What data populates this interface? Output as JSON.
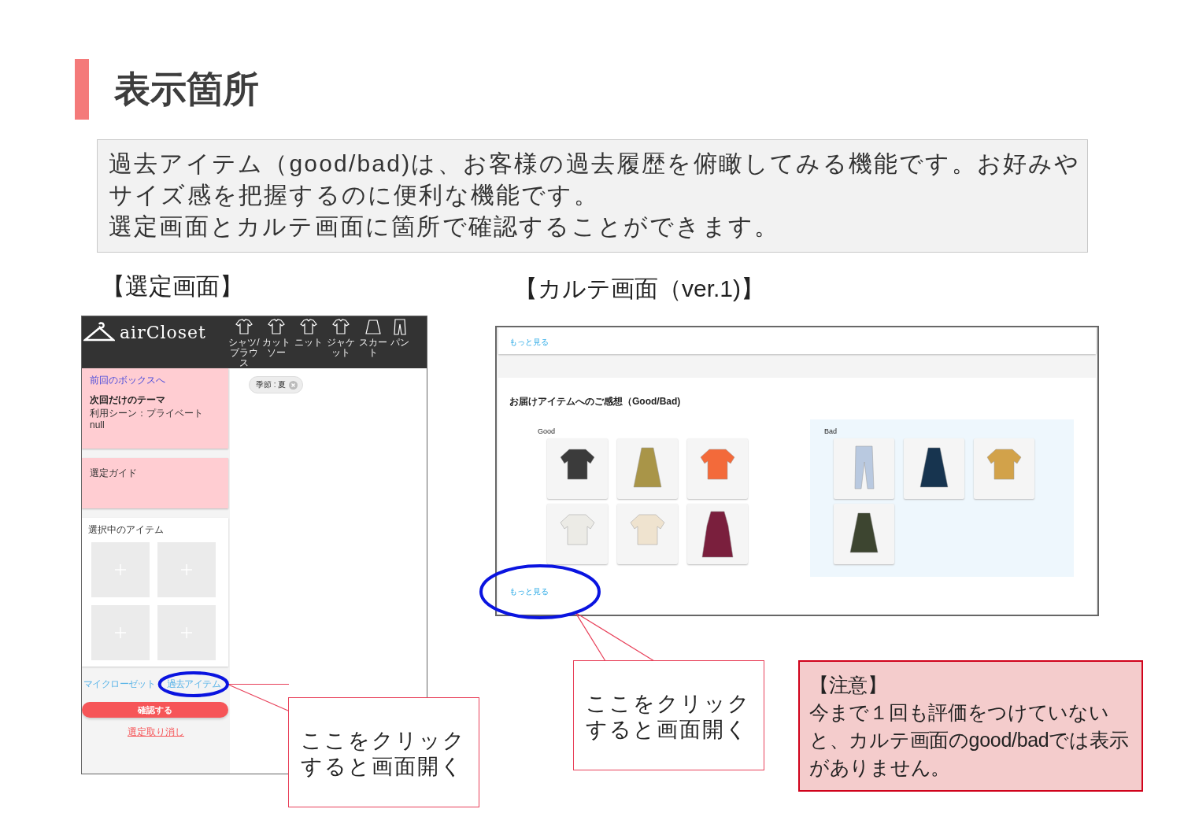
{
  "slide": {
    "title": "表示箇所",
    "description": [
      "過去アイテム（good/bad)は、お客様の過去履歴を俯瞰してみる機能です。お好みやサイズ感を把握するのに便利な機能です。",
      "選定画面とカルテ画面に箇所で確認することができます。"
    ]
  },
  "selection_section": {
    "heading": "【選定画面】",
    "screen": {
      "logo": "airCloset",
      "nav": [
        {
          "label": "シャツ/ブラウス",
          "kind": "shirt"
        },
        {
          "label": "カットソー",
          "kind": "shirt"
        },
        {
          "label": "ニット",
          "kind": "shirt"
        },
        {
          "label": "ジャケット",
          "kind": "shirt"
        },
        {
          "label": "スカート",
          "kind": "skirt"
        },
        {
          "label": "パン",
          "kind": "pants"
        }
      ],
      "previous_box_link": "前回のボックスへ",
      "theme_title": "次回だけのテーマ",
      "theme_lines": [
        "利用シーン：プライベート",
        "null"
      ],
      "guide": "選定ガイド",
      "selected_title": "選択中のアイテム",
      "slots": [
        {
          "kind": "empty"
        },
        {
          "kind": "empty"
        },
        {
          "kind": "empty"
        },
        {
          "kind": "empty"
        }
      ],
      "links": [
        "マイクローゼット",
        "過去アイテム"
      ],
      "confirm_button": "確認する",
      "cancel_link": "選定取り消し",
      "filter_chip": "季節 : 夏"
    }
  },
  "karte_section": {
    "heading": "【カルテ画面（ver.1)】",
    "screen": {
      "top_link": "もっと見る",
      "title": "お届けアイテムへのご感想（Good/Bad)",
      "good": {
        "label": "Good",
        "items": [
          {
            "kind": "top",
            "color": "#3b3b3b"
          },
          {
            "kind": "skirt",
            "color": "#a99548"
          },
          {
            "kind": "top",
            "color": "#f36a3a"
          },
          {
            "kind": "top",
            "color": "#ecebe6"
          },
          {
            "kind": "top",
            "color": "#efe3cf"
          },
          {
            "kind": "dress",
            "color": "#7a1f3d"
          }
        ]
      },
      "bad": {
        "label": "Bad",
        "items": [
          {
            "kind": "pants",
            "color": "#b9c9e0"
          },
          {
            "kind": "skirt",
            "color": "#17344f"
          },
          {
            "kind": "top",
            "color": "#d2a24a"
          },
          {
            "kind": "skirt",
            "color": "#3d4530"
          }
        ]
      },
      "bottom_link": "もっと見る"
    }
  },
  "callouts": [
    "ここをクリックすると画面開く",
    "ここをクリックすると画面開く"
  ],
  "note": {
    "title": "【注意】",
    "text": "今まで１回も評価をつけていないと、カルテ画面のgood/badでは表示がありません。"
  }
}
